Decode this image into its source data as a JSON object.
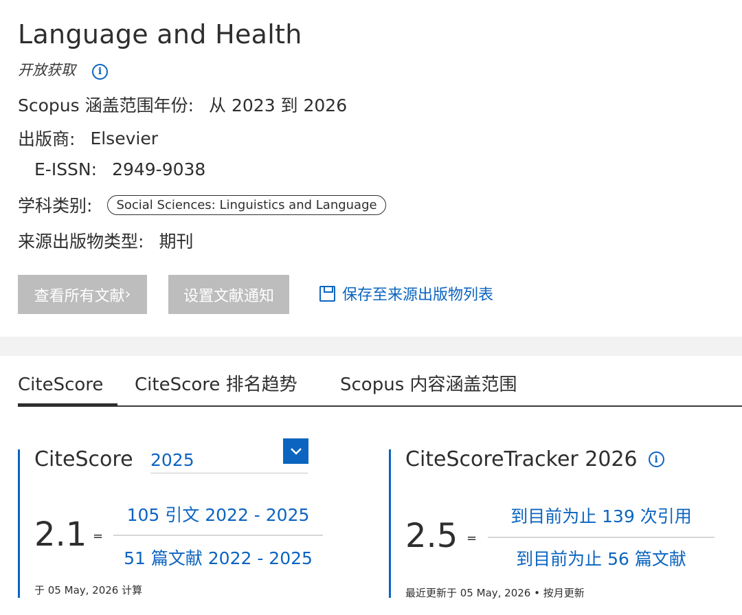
{
  "journal": {
    "title": "Language and Health",
    "open_access": "开放获取",
    "coverage_label": "Scopus 涵盖范围年份:",
    "coverage_value": "从 2023 到 2026",
    "publisher_label": "出版商:",
    "publisher_value": "Elsevier",
    "issn_label": "E-ISSN:",
    "issn_value": "2949-9038",
    "subject_label": "学科类别:",
    "subject_chip": "Social Sciences: Linguistics and Language",
    "source_type_label": "来源出版物类型:",
    "source_type_value": "期刊"
  },
  "actions": {
    "view_docs": "查看所有文献",
    "view_docs_chevron": "›",
    "set_alert": "设置文献通知",
    "save_to_list": "保存至来源出版物列表"
  },
  "tabs": [
    {
      "label": "CiteScore",
      "active": true
    },
    {
      "label": "CiteScore 排名趋势",
      "active": false
    },
    {
      "label": "Scopus 内容涵盖范围",
      "active": false
    }
  ],
  "citescore": {
    "title": "CiteScore",
    "year": "2025",
    "value": "2.1",
    "equals": "=",
    "numerator": "105 引文 2022 - 2025",
    "denominator": "51 篇文献 2022 - 2025",
    "footnote": "于 05 May, 2026 计算"
  },
  "tracker": {
    "title": "CiteScoreTracker 2026",
    "value": "2.5",
    "equals": "=",
    "numerator": "到目前为止 139 次引用",
    "denominator": "到目前为止 56 篇文献",
    "footnote": "最近更新于 05 May, 2026 • 按月更新"
  },
  "colors": {
    "accent": "#0b64c0",
    "button_disabled": "#bdbdbd",
    "text": "#2e2e2e"
  },
  "icons": [
    "info-icon",
    "save-list-icon",
    "chevron-down-icon"
  ]
}
